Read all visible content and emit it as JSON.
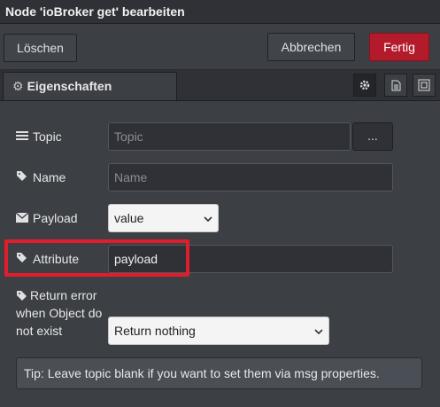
{
  "window": {
    "title": "Node 'ioBroker get' bearbeiten"
  },
  "toolbar": {
    "delete_label": "Löschen",
    "cancel_label": "Abbrechen",
    "done_label": "Fertig"
  },
  "tabs": {
    "properties_label": "Eigenschaften"
  },
  "form": {
    "topic": {
      "label": "Topic",
      "placeholder": "Topic",
      "browse_label": "..."
    },
    "name": {
      "label": "Name",
      "placeholder": "Name"
    },
    "payload": {
      "label": "Payload",
      "value": "value"
    },
    "attribute": {
      "label": "Attribute",
      "value": "payload"
    },
    "return_error": {
      "label": "Return error when Object do not exist",
      "value": "Return nothing"
    }
  },
  "tip": "Tip: Leave topic blank if you want to set them via msg properties.",
  "colors": {
    "accent": "#b31b2a",
    "highlight": "#e01e2b",
    "background": "#3c3f44"
  }
}
